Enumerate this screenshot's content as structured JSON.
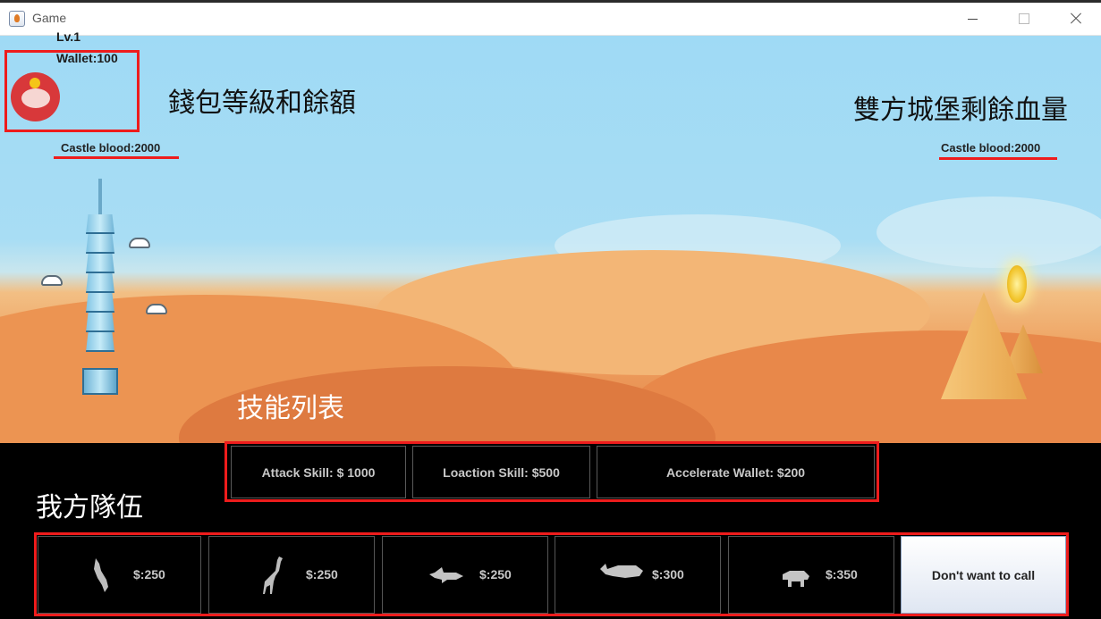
{
  "window": {
    "title": "Game"
  },
  "hud": {
    "level": "Lv.1",
    "wallet": "Wallet:100",
    "player_castle_blood": "Castle blood:2000",
    "enemy_castle_blood": "Castle blood:2000"
  },
  "annotations": {
    "wallet_info": "錢包等級和餘額",
    "castle_blood": "雙方城堡剩餘血量",
    "skill_list": "技能列表",
    "our_team": "我方隊伍"
  },
  "skills": [
    {
      "label": "Attack Skill: $ 1000"
    },
    {
      "label": "Loaction Skill: $500"
    },
    {
      "label": "Accelerate Wallet: $200"
    }
  ],
  "units": [
    {
      "icon": "lizard-icon",
      "price": "$:250"
    },
    {
      "icon": "giraffe-icon",
      "price": "$:250"
    },
    {
      "icon": "shark-icon",
      "price": "$:250"
    },
    {
      "icon": "whale-icon",
      "price": "$:300"
    },
    {
      "icon": "hippo-icon",
      "price": "$:350"
    }
  ],
  "dont_call_label": "Don't want to call",
  "colors": {
    "highlight_red": "#ee1c1c",
    "sky": "#9fdaf5",
    "sand": "#ee9f5e",
    "panel_bg": "#000000"
  }
}
